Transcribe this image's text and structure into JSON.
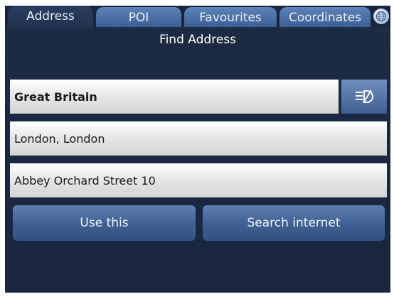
{
  "tabs": [
    {
      "label": "Address",
      "active": true
    },
    {
      "label": "POI",
      "active": false
    },
    {
      "label": "Favourites",
      "active": false
    },
    {
      "label": "Coordinates",
      "active": false
    }
  ],
  "title": "Find Address",
  "fields": {
    "country": "Great Britain",
    "city": "London, London",
    "street": "Abbey Orchard Street 10"
  },
  "buttons": {
    "use_this": "Use this",
    "search_internet": "Search internet"
  },
  "icons": {
    "globe": "globe-icon",
    "keyboard": "keyboard-icon"
  },
  "colors": {
    "background": "#1d2a44",
    "tab": "#4d71a6",
    "button": "#4a6b9e"
  }
}
